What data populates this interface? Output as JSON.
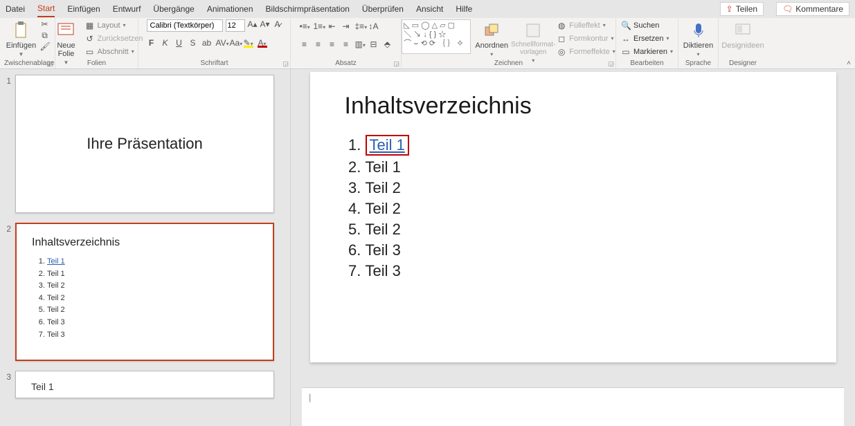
{
  "tabs": {
    "items": [
      "Datei",
      "Start",
      "Einfügen",
      "Entwurf",
      "Übergänge",
      "Animationen",
      "Bildschirmpräsentation",
      "Überprüfen",
      "Ansicht",
      "Hilfe"
    ],
    "active": "Start"
  },
  "corner": {
    "share": "Teilen",
    "comments": "Kommentare"
  },
  "ribbon": {
    "clipboard": {
      "paste": "Einfügen",
      "label": "Zwischenablage"
    },
    "slides": {
      "new": "Neue Folie",
      "layout": "Layout",
      "reset": "Zurücksetzen",
      "section": "Abschnitt",
      "label": "Folien"
    },
    "font": {
      "name": "Calibri (Textkörper)",
      "size": "12",
      "label": "Schriftart"
    },
    "paragraph": {
      "label": "Absatz"
    },
    "drawing": {
      "arrange": "Anordnen",
      "quick": "Schnellformat-vorlagen",
      "fill": "Fülleffekt",
      "outline": "Formkontur",
      "effects": "Formeffekte",
      "label": "Zeichnen"
    },
    "editing": {
      "find": "Suchen",
      "replace": "Ersetzen",
      "select": "Markieren",
      "label": "Bearbeiten"
    },
    "voice": {
      "dictate": "Diktieren",
      "label": "Sprache"
    },
    "designer": {
      "ideas": "Designideen",
      "label": "Designer"
    }
  },
  "thumbnails": {
    "slide1": {
      "num": "1",
      "title": "Ihre Präsentation"
    },
    "slide2": {
      "num": "2",
      "title": "Inhaltsverzeichnis",
      "items": [
        "Teil 1",
        "Teil 1",
        "Teil 2",
        "Teil 2",
        "Teil 2",
        "Teil 3",
        "Teil 3"
      ]
    },
    "slide3": {
      "num": "3",
      "title": "Teil 1"
    }
  },
  "slide": {
    "title": "Inhaltsverzeichnis",
    "items": [
      "Teil 1",
      "Teil 1",
      "Teil 2",
      "Teil 2",
      "Teil 2",
      "Teil 3",
      "Teil 3"
    ]
  },
  "notes": {
    "cursor": "|"
  }
}
